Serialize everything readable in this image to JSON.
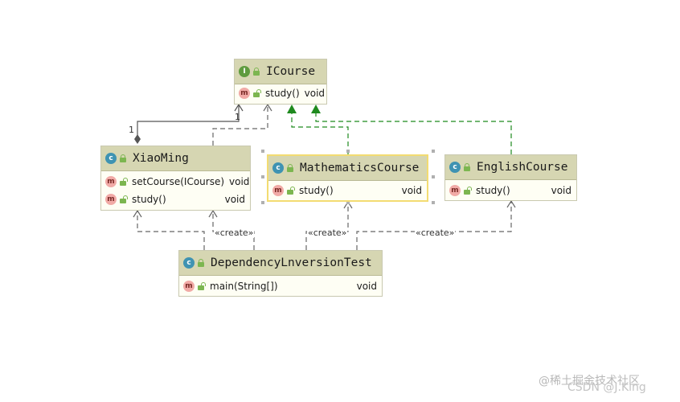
{
  "icourse": {
    "icon": "interface-icon",
    "icon_letter": "I",
    "title": "ICourse",
    "rows": [
      {
        "icon": "m",
        "name": "study()",
        "type": "void"
      }
    ]
  },
  "xiaoming": {
    "icon": "class-icon",
    "icon_letter": "c",
    "title": "XiaoMing",
    "rows": [
      {
        "icon": "m",
        "name": "setCourse(ICourse)",
        "type": "void"
      },
      {
        "icon": "m",
        "name": "study()",
        "type": "void"
      }
    ]
  },
  "math": {
    "icon": "class-icon",
    "icon_letter": "c",
    "title": "MathematicsCourse",
    "rows": [
      {
        "icon": "m",
        "name": "study()",
        "type": "void"
      }
    ]
  },
  "english": {
    "icon": "class-icon",
    "icon_letter": "c",
    "title": "EnglishCourse",
    "rows": [
      {
        "icon": "m",
        "name": "study()",
        "type": "void"
      }
    ]
  },
  "test": {
    "icon": "class-icon",
    "icon_letter": "c",
    "title": "DependencyLnversionTest",
    "rows": [
      {
        "icon": "m",
        "name": "main(String[])",
        "type": "void"
      }
    ]
  },
  "labels": {
    "multiplicity_one_a": "1",
    "multiplicity_one_b": "1",
    "create_a": "«create»",
    "create_b": "«create»",
    "create_c": "«create»"
  },
  "colors": {
    "realization": "#1f8a1f",
    "dependency": "#666666",
    "header": "#d6d6b2"
  },
  "watermark": {
    "line1": "@稀土掘金技术社区",
    "line2": "CSDN @J.King"
  }
}
